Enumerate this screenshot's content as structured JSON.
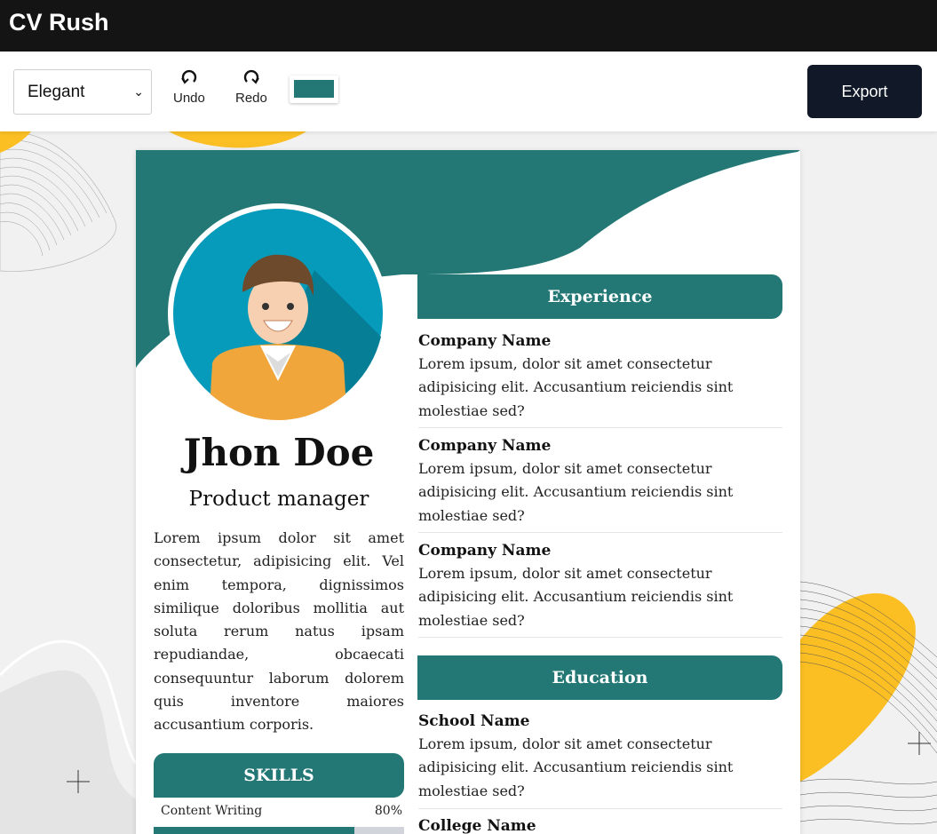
{
  "app": {
    "title": "CV Rush"
  },
  "toolbar": {
    "template_value": "Elegant",
    "undo_label": "Undo",
    "redo_label": "Redo",
    "color_value": "#237875",
    "export_label": "Export"
  },
  "colors": {
    "accent": "#237875",
    "topbar": "#141414",
    "export": "#111827",
    "decor_yellow": "#fbbf24"
  },
  "cv": {
    "name": "Jhon Doe",
    "role": "Product manager",
    "bio": "Lorem ipsum dolor sit amet consectetur, adipisicing elit. Vel enim tempora, dignissimos similique doloribus mollitia aut soluta rerum natus ipsam repudiandae, obcaecati consequuntur laborum dolorem quis inventore maiores accusantium corporis.",
    "skills_title": "SKILLS",
    "skills": [
      {
        "name": "Content Writing",
        "percent_label": "80%",
        "level": 0.8
      }
    ],
    "experience_title": "Experience",
    "experience": [
      {
        "title": "Company Name",
        "desc": "Lorem ipsum, dolor sit amet consectetur adipisicing elit. Accusantium reiciendis sint molestiae sed?"
      },
      {
        "title": "Company Name",
        "desc": "Lorem ipsum, dolor sit amet consectetur adipisicing elit. Accusantium reiciendis sint molestiae sed?"
      },
      {
        "title": "Company Name",
        "desc": "Lorem ipsum, dolor sit amet consectetur adipisicing elit. Accusantium reiciendis sint molestiae sed?"
      }
    ],
    "education_title": "Education",
    "education": [
      {
        "title": "School Name",
        "desc": "Lorem ipsum, dolor sit amet consectetur adipisicing elit. Accusantium reiciendis sint molestiae sed?"
      },
      {
        "title": "College Name",
        "desc": ""
      }
    ]
  }
}
